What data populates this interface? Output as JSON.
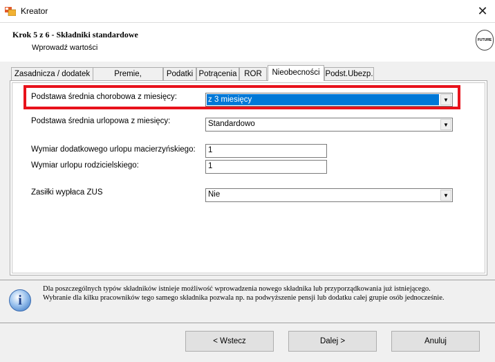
{
  "window": {
    "title": "Kreator",
    "close_glyph": "✕",
    "icon": "app-window-icon"
  },
  "header": {
    "step_title": "Krok 5 z 6 - Składniki standardowe",
    "step_subtitle": "Wprowadź wartości",
    "logo_text": "FUTURE",
    "logo_icon": "company-logo"
  },
  "tabs": [
    {
      "label": "Zasadnicza / dodatek",
      "active": false
    },
    {
      "label": "Premie, nadgodziny",
      "active": false
    },
    {
      "label": "Podatki",
      "active": false
    },
    {
      "label": "Potrącenia",
      "active": false
    },
    {
      "label": "ROR",
      "active": false
    },
    {
      "label": "Nieobecności",
      "active": true
    },
    {
      "label": "Podst.Ubezp.",
      "active": false
    }
  ],
  "form": {
    "sick_basis_label": "Podstawa średnia chorobowa z miesięcy:",
    "sick_basis_value": "z 3 miesięcy",
    "vacation_basis_label": "Podstawa średnia urlopowa z miesięcy:",
    "vacation_basis_value": "Standardowo",
    "maternity_extra_label": "Wymiar dodatkowego urlopu macierzyńskiego:",
    "maternity_extra_value": "1",
    "parental_label": "Wymiar urlopu rodzicielskiego:",
    "parental_value": "1",
    "zus_label": "Zasiłki wypłaca ZUS",
    "zus_value": "Nie",
    "dropdown_arrow": "▼"
  },
  "info": {
    "icon": "info-icon",
    "line1": "Dla poszczególnych typów składników istnieje możliwość wprowadzenia nowego składnika lub przyporządkowania już istniejącego.",
    "line2": "Wybranie dla kilku pracowników tego samego składnika pozwala np. na podwyższenie pensji lub dodatku całej grupie osób jednocześnie."
  },
  "buttons": {
    "back": "< Wstecz",
    "next": "Dalej >",
    "cancel": "Anuluj"
  },
  "colors": {
    "highlight": "#e8121b",
    "selection": "#0078d7"
  }
}
